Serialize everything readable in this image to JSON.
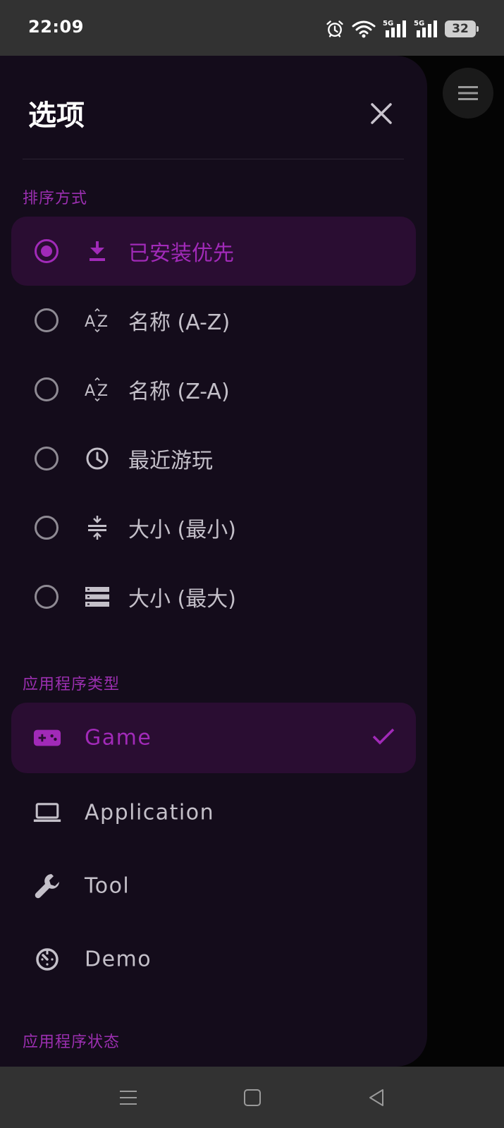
{
  "status_bar": {
    "time": "22:09",
    "battery": "32",
    "network_1": "5G",
    "network_2": "5G"
  },
  "drawer": {
    "title": "选项",
    "sort_section": {
      "label": "排序方式",
      "options": [
        {
          "label": "已安装优先",
          "icon": "download-icon",
          "selected": true
        },
        {
          "label": "名称 (A-Z)",
          "icon": "sort-az-icon",
          "selected": false
        },
        {
          "label": "名称 (Z-A)",
          "icon": "sort-za-icon",
          "selected": false
        },
        {
          "label": "最近游玩",
          "icon": "clock-icon",
          "selected": false
        },
        {
          "label": "大小 (最小)",
          "icon": "compress-icon",
          "selected": false
        },
        {
          "label": "大小 (最大)",
          "icon": "storage-icon",
          "selected": false
        }
      ]
    },
    "type_section": {
      "label": "应用程序类型",
      "options": [
        {
          "label": "Game",
          "icon": "gamepad-icon",
          "checked": true
        },
        {
          "label": "Application",
          "icon": "laptop-icon",
          "checked": false
        },
        {
          "label": "Tool",
          "icon": "wrench-icon",
          "checked": false
        },
        {
          "label": "Demo",
          "icon": "timer-icon",
          "checked": false
        }
      ]
    },
    "status_section": {
      "label": "应用程序状态"
    }
  },
  "colors": {
    "accent": "#a12ab8",
    "drawer_bg": "#140c1b",
    "selected_bg": "#2a0d32",
    "text": "#c4c0c9"
  }
}
